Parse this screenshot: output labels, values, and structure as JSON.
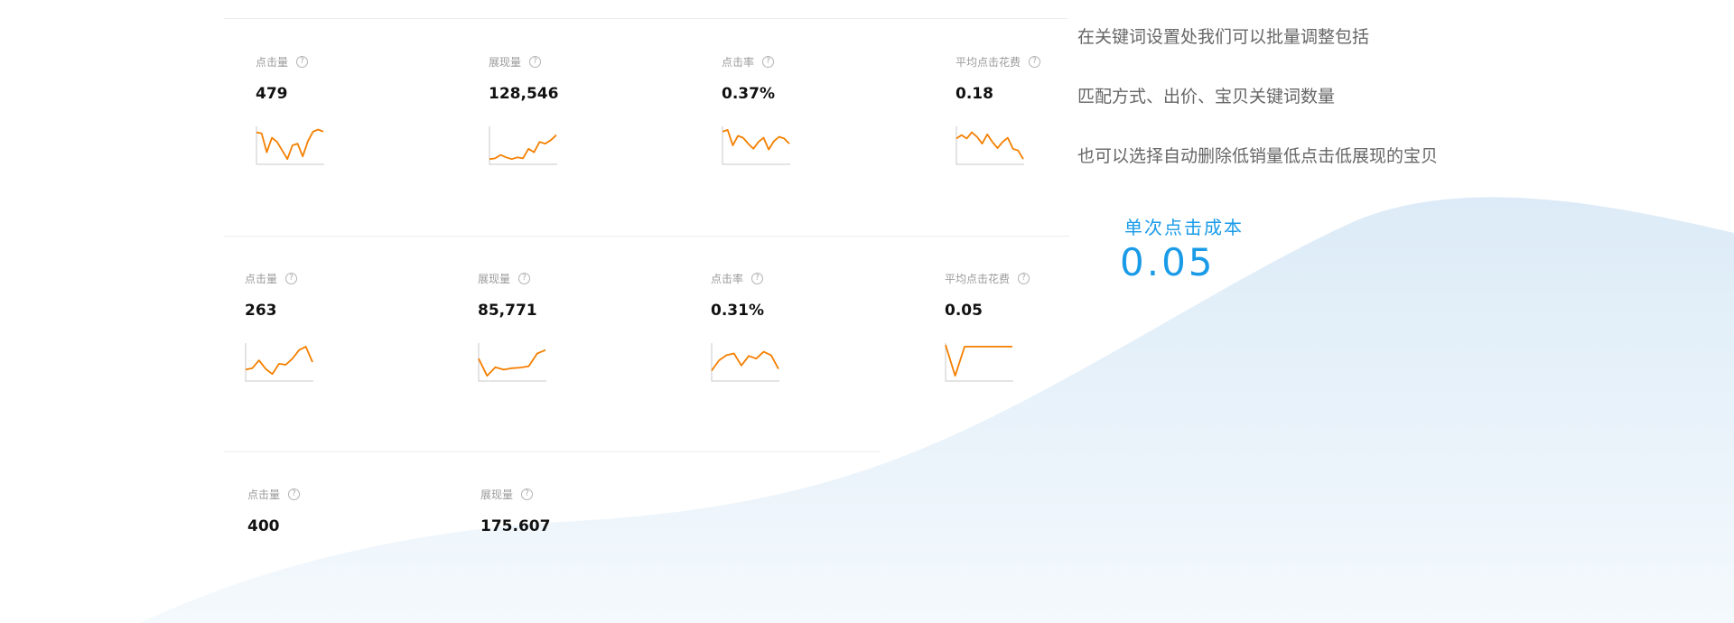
{
  "panel": {
    "row1": [
      {
        "label": "点击量",
        "value": "479",
        "trend": [
          0.88,
          0.85,
          0.3,
          0.72,
          0.6,
          0.35,
          0.1,
          0.5,
          0.55,
          0.18,
          0.62,
          0.9,
          0.96,
          0.9
        ]
      },
      {
        "label": "展现量",
        "value": "128,546",
        "trend": [
          0.1,
          0.12,
          0.22,
          0.15,
          0.1,
          0.15,
          0.12,
          0.4,
          0.3,
          0.6,
          0.55,
          0.65,
          0.8
        ]
      },
      {
        "label": "点击率",
        "value": "0.37%",
        "trend": [
          0.9,
          0.95,
          0.5,
          0.78,
          0.72,
          0.55,
          0.4,
          0.6,
          0.72,
          0.38,
          0.62,
          0.75,
          0.7,
          0.55
        ]
      },
      {
        "label": "平均点击花费",
        "value": "0.18",
        "trend": [
          0.7,
          0.8,
          0.7,
          0.88,
          0.75,
          0.55,
          0.82,
          0.6,
          0.42,
          0.6,
          0.72,
          0.4,
          0.35,
          0.1
        ]
      }
    ],
    "row2": [
      {
        "label": "点击量",
        "value": "263",
        "trend": [
          0.28,
          0.32,
          0.55,
          0.3,
          0.15,
          0.45,
          0.42,
          0.6,
          0.85,
          0.95,
          0.5
        ]
      },
      {
        "label": "展现量",
        "value": "85,771",
        "trend": [
          0.6,
          0.1,
          0.35,
          0.28,
          0.32,
          0.34,
          0.38,
          0.75,
          0.85
        ]
      },
      {
        "label": "点击率",
        "value": "0.31%",
        "trend": [
          0.25,
          0.55,
          0.7,
          0.75,
          0.4,
          0.68,
          0.6,
          0.8,
          0.7,
          0.3
        ]
      },
      {
        "label": "平均点击花费",
        "value": "0.05",
        "trend": [
          1,
          0.1,
          0.95,
          0.95,
          0.95,
          0.95,
          0.95,
          0.95
        ]
      }
    ],
    "row3": [
      {
        "label": "点击量",
        "value": "400"
      },
      {
        "label": "展现量",
        "value": "175,607"
      }
    ],
    "help_glyph": "?"
  },
  "notes": [
    "在关键词设置处我们可以批量调整包括",
    "匹配方式、出价、宝贝关键词数量",
    "也可以选择自动删除低销量低点击低展现的宝贝"
  ],
  "cost": {
    "label": "单次点击成本",
    "value": "0.05"
  },
  "colors": {
    "spark": "#f47f00",
    "accent": "#1a9be8",
    "wave_top": "#dcebf7",
    "wave_bottom": "#f3f8fc"
  }
}
